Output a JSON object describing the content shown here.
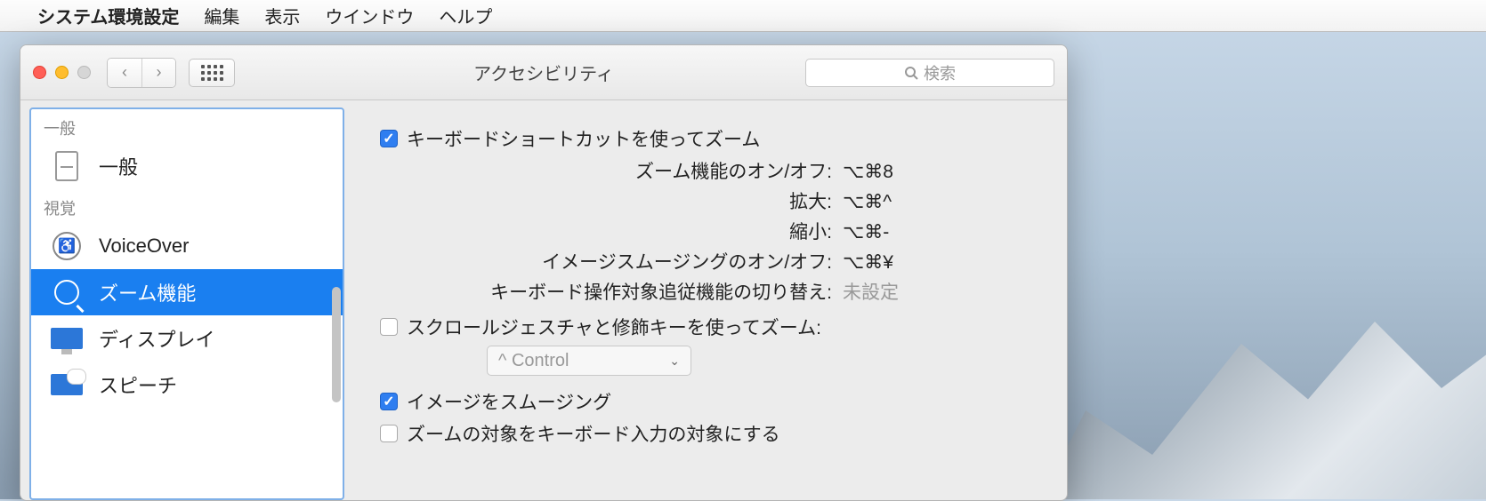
{
  "menubar": {
    "app": "システム環境設定",
    "items": [
      "編集",
      "表示",
      "ウインドウ",
      "ヘルプ"
    ]
  },
  "window": {
    "title": "アクセシビリティ",
    "search_placeholder": "検索"
  },
  "sidebar": {
    "groups": [
      {
        "header": "一般",
        "items": [
          {
            "label": "一般",
            "icon": "general"
          }
        ]
      },
      {
        "header": "視覚",
        "items": [
          {
            "label": "VoiceOver",
            "icon": "voiceover"
          },
          {
            "label": "ズーム機能",
            "icon": "zoom",
            "selected": true
          },
          {
            "label": "ディスプレイ",
            "icon": "display"
          },
          {
            "label": "スピーチ",
            "icon": "speech"
          }
        ]
      }
    ]
  },
  "pane": {
    "keyboard_zoom": {
      "label": "キーボードショートカットを使ってズーム",
      "checked": true,
      "shortcuts": [
        {
          "label": "ズーム機能のオン/オフ:",
          "value": "⌥⌘8"
        },
        {
          "label": "拡大:",
          "value": "⌥⌘^"
        },
        {
          "label": "縮小:",
          "value": "⌥⌘-"
        },
        {
          "label": "イメージスムージングのオン/オフ:",
          "value": "⌥⌘¥"
        },
        {
          "label": "キーボード操作対象追従機能の切り替え:",
          "value": "未設定",
          "unset": true
        }
      ]
    },
    "scroll_zoom": {
      "label": "スクロールジェスチャと修飾キーを使ってズーム:",
      "checked": false,
      "modifier": "^ Control"
    },
    "smooth": {
      "label": "イメージをスムージング",
      "checked": true
    },
    "follow_keyboard": {
      "label": "ズームの対象をキーボード入力の対象にする",
      "checked": false
    }
  }
}
